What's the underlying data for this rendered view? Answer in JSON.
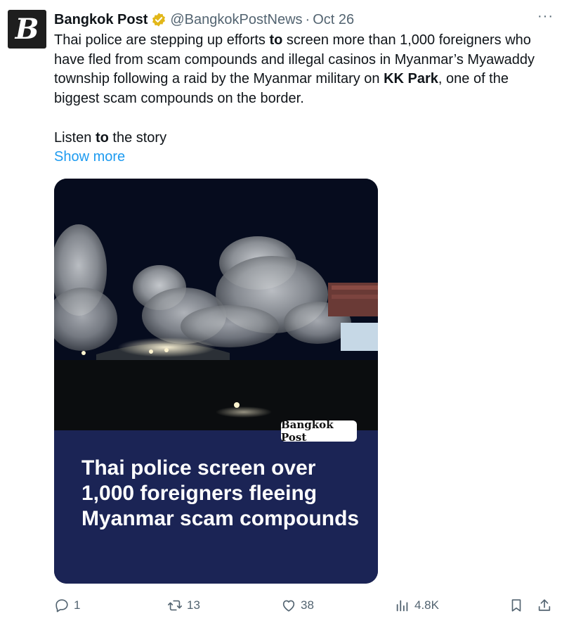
{
  "author": {
    "name": "Bangkok Post",
    "handle": "@BangkokPostNews",
    "separator": "·",
    "time": "Oct 26",
    "avatar_letter": "B"
  },
  "more_label": "···",
  "text": {
    "p1_a": "Thai police are stepping up efforts ",
    "p1_b": "to",
    "p1_c": " screen more than 1,000 foreigners who have fled from scam compounds and illegal casinos in Myanmar’s Myawaddy township following a raid by the Myanmar military on ",
    "p1_d": "KK Park",
    "p1_e": ", one of the biggest scam compounds on the border.",
    "p2_a": "Listen ",
    "p2_b": "to",
    "p2_c": " the story",
    "show_more": "Show more"
  },
  "media": {
    "watermark": "Bangkok Post",
    "caption": [
      "Thai police screen over",
      "1,000 foreigners fleeing",
      "Myanmar scam compounds"
    ]
  },
  "actions": {
    "replies": "1",
    "reposts": "13",
    "likes": "38",
    "views": "4.8K"
  },
  "colors": {
    "accent": "#1d9bf0",
    "muted": "#536471",
    "verified": "#e2b719",
    "caption_bg": "#1b2455"
  },
  "icons": [
    "reply-icon",
    "repost-icon",
    "like-icon",
    "views-icon",
    "bookmark-icon",
    "share-icon",
    "verified-badge-icon",
    "more-icon"
  ]
}
